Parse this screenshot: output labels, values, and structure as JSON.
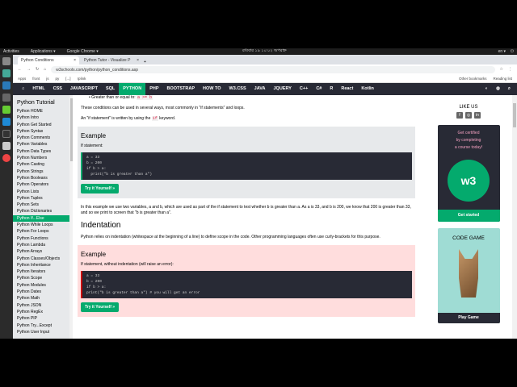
{
  "desktop": {
    "activities": "Activities",
    "applications": "Applications ▾",
    "app": "Google Chrome ▾",
    "clock": "রবিবার ১৯ ১০:০২ অপরাহ্ন",
    "lang": "en ▾"
  },
  "browser": {
    "tabs": [
      {
        "label": "Python Conditions",
        "close": "×"
      },
      {
        "label": "Python Tutor - Visualize P",
        "close": "×"
      }
    ],
    "new_tab": "+",
    "url": "w3schools.com/python/python_conditions.asp",
    "bookmarks": [
      "Apps",
      "front",
      "js",
      "py",
      "[...]",
      "rplink"
    ],
    "other_bookmarks": "Other bookmarks",
    "reading_list": "Reading list"
  },
  "nav": {
    "home": "⌂",
    "items": [
      "HTML",
      "CSS",
      "JAVASCRIPT",
      "SQL",
      "PYTHON",
      "PHP",
      "BOOTSTRAP",
      "HOW TO",
      "W3.CSS",
      "JAVA",
      "JQUERY",
      "C++",
      "C#",
      "R",
      "React",
      "Kotlin"
    ],
    "active": "PYTHON"
  },
  "sidebar": {
    "title": "Python Tutorial",
    "items": [
      "Python HOME",
      "Python Intro",
      "Python Get Started",
      "Python Syntax",
      "Python Comments",
      "Python Variables",
      "Python Data Types",
      "Python Numbers",
      "Python Casting",
      "Python Strings",
      "Python Booleans",
      "Python Operators",
      "Python Lists",
      "Python Tuples",
      "Python Sets",
      "Python Dictionaries",
      "Python If...Else",
      "Python While Loops",
      "Python For Loops",
      "Python Functions",
      "Python Lambda",
      "Python Arrays",
      "Python Classes/Objects",
      "Python Inheritance",
      "Python Iterators",
      "Python Scope",
      "Python Modules",
      "Python Dates",
      "Python Math",
      "Python JSON",
      "Python RegEx",
      "Python PIP",
      "Python Try...Except",
      "Python User Input"
    ],
    "active": "Python If...Else"
  },
  "content": {
    "bullet": "Greater than or equal to: ",
    "bullet_code": "a >= b",
    "p1": "These conditions can be used in several ways, most commonly in \"if statements\" and loops.",
    "p2a": "An \"if statement\" is written by using the ",
    "p2code": "if",
    "p2b": " keyword.",
    "ex1": {
      "title": "Example",
      "label": "If statement:",
      "code": "a = 33\nb = 200\nif b > a:\n  print(\"b is greater than a\")",
      "button": "Try it Yourself »"
    },
    "p3": "In this example we use two variables, a and b, which are used as part of the if statement to test whether b is greater than a. As a is 33, and b is 200, we know that 200 is greater than 33, and so we print to screen that \"b is greater than a\".",
    "h_indent": "Indentation",
    "p4": "Python relies on indentation (whitespace at the beginning of a line) to define scope in the code. Other programming languages often use curly-brackets for this purpose.",
    "ex2": {
      "title": "Example",
      "label": "If statement, without indentation (will raise an error):",
      "code": "a = 33\nb = 200\nif b > a:\nprint(\"b is greater than a\") # you will get an error",
      "button": "Try it Yourself »"
    }
  },
  "right": {
    "like": "LIKE US",
    "cert_text": "Get certified\nby completing\na course today!",
    "badge": "w3",
    "cert_button": "Get started",
    "game_title": "CODE GAME",
    "game_button": "Play Game"
  }
}
